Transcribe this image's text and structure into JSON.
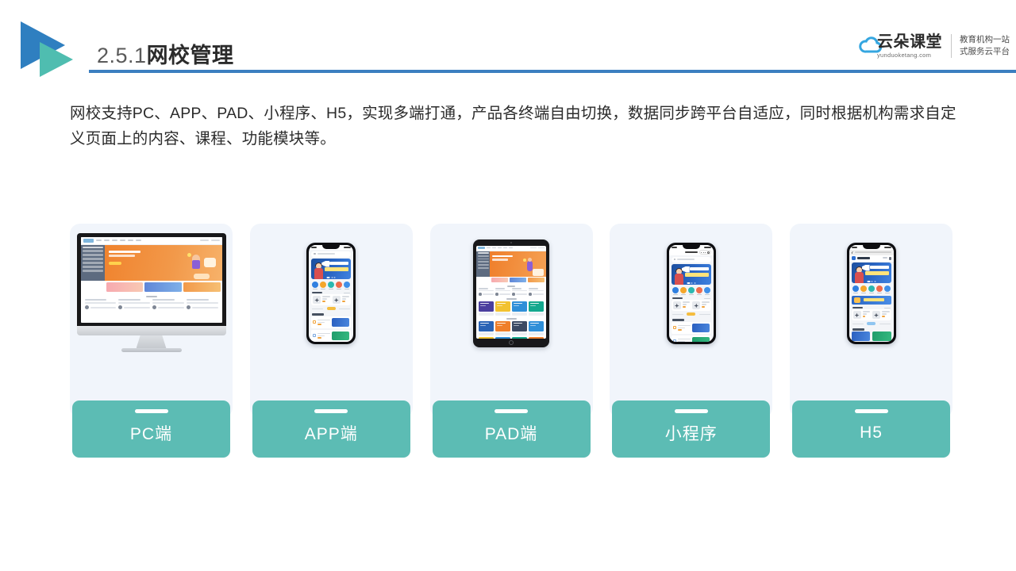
{
  "header": {
    "section_number": "2.5.1",
    "title_zh": "网校管理",
    "logo_icon": "triangle-play-logo",
    "brand": {
      "cloud_icon": "cloud-icon",
      "name_cn": "云朵课堂",
      "url": "yunduoketang.com",
      "tagline_line1": "教育机构一站",
      "tagline_line2": "式服务云平台"
    },
    "rule_color": "#3b7fc0"
  },
  "lead_paragraph": "网校支持PC、APP、PAD、小程序、H5，实现多端打通，产品各终端自由切换，数据同步跨平台自适应，同时根据机构需求自定义页面上的内容、课程、功能模块等。",
  "colors": {
    "accent_teal": "#5cbcb4",
    "accent_blue": "#3b7fc0",
    "logo_blue": "#2f7fc0",
    "logo_teal": "#4fbdb0",
    "panel_bg": "#f1f5fb",
    "banner_orange": "#f0832e",
    "banner_blue": "#2a66c4"
  },
  "cards": [
    {
      "id": "pc",
      "label": "PC端",
      "device": "desktop-monitor"
    },
    {
      "id": "app",
      "label": "APP端",
      "device": "smartphone"
    },
    {
      "id": "pad",
      "label": "PAD端",
      "device": "tablet"
    },
    {
      "id": "miniapp",
      "label": "小程序",
      "device": "smartphone-miniprogram"
    },
    {
      "id": "h5",
      "label": "H5",
      "device": "smartphone-browser"
    }
  ]
}
